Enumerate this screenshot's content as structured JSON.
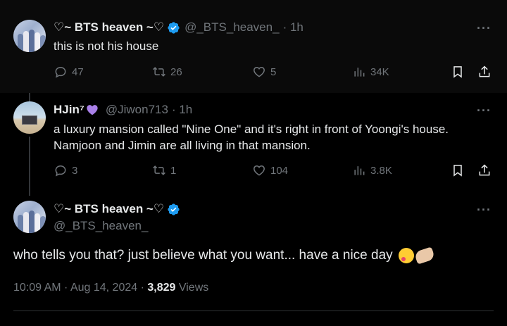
{
  "tweets": [
    {
      "display_name": "♡~ BTS heaven ~♡",
      "handle": "@_BTS_heaven_",
      "time": "· 1h",
      "text": "this is not his house",
      "replies": "47",
      "retweets": "26",
      "likes": "5",
      "views": "34K"
    },
    {
      "display_name": "HJin⁷",
      "handle": "@Jiwon713",
      "time": "· 1h",
      "text_lines": [
        "a luxury mansion called \"Nine One\" and it's right in front of Yoongi's house.",
        "Namjoon and Jimin are all living in that mansion."
      ],
      "replies": "3",
      "retweets": "1",
      "likes": "104",
      "views": "3.8K"
    }
  ],
  "main_tweet": {
    "display_name": "♡~ BTS heaven ~♡",
    "handle": "@_BTS_heaven_",
    "text": "who tells you that? just believe what you want... have a nice day",
    "timestamp": "10:09 AM · Aug 14, 2024 · ",
    "views_count": "3,829",
    "views_label": " Views"
  },
  "more_label": "···",
  "colors": {
    "verified": "#1d9bf0",
    "muted": "#71767b",
    "purple_heart": "#a980e8"
  }
}
